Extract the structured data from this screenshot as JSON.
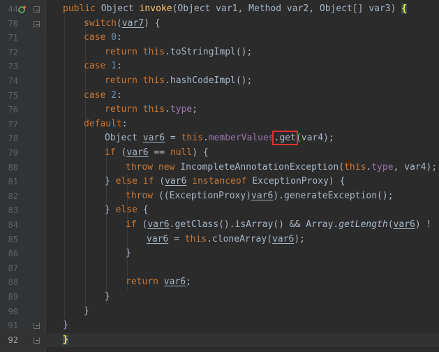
{
  "editor": {
    "lines": [
      {
        "num": "44",
        "tokens": [
          {
            "t": "public",
            "c": "kw"
          },
          {
            "t": " "
          },
          {
            "t": "Object"
          },
          {
            "t": " "
          },
          {
            "t": "invoke",
            "c": "fn"
          },
          {
            "t": "(Object var1, Method var2, Object[] var3) "
          },
          {
            "t": "{",
            "c": "brace-hl"
          }
        ],
        "indent": 0
      },
      {
        "num": "70",
        "tokens": [
          {
            "t": "switch",
            "c": "kw"
          },
          {
            "t": "("
          },
          {
            "t": "var7",
            "c": "var"
          },
          {
            "t": ") {"
          }
        ],
        "indent": 2
      },
      {
        "num": "71",
        "tokens": [
          {
            "t": "case ",
            "c": "kw"
          },
          {
            "t": "0",
            "c": "num"
          },
          {
            "t": ":"
          }
        ],
        "indent": 2
      },
      {
        "num": "72",
        "tokens": [
          {
            "t": "return ",
            "c": "kw"
          },
          {
            "t": "this",
            "c": "kw"
          },
          {
            "t": ".toStringImpl();"
          }
        ],
        "indent": 3
      },
      {
        "num": "73",
        "tokens": [
          {
            "t": "case ",
            "c": "kw"
          },
          {
            "t": "1",
            "c": "num"
          },
          {
            "t": ":"
          }
        ],
        "indent": 2
      },
      {
        "num": "74",
        "tokens": [
          {
            "t": "return ",
            "c": "kw"
          },
          {
            "t": "this",
            "c": "kw"
          },
          {
            "t": ".hashCodeImpl();"
          }
        ],
        "indent": 3
      },
      {
        "num": "75",
        "tokens": [
          {
            "t": "case ",
            "c": "kw"
          },
          {
            "t": "2",
            "c": "num"
          },
          {
            "t": ":"
          }
        ],
        "indent": 2
      },
      {
        "num": "76",
        "tokens": [
          {
            "t": "return ",
            "c": "kw"
          },
          {
            "t": "this",
            "c": "kw"
          },
          {
            "t": "."
          },
          {
            "t": "type",
            "c": "fld"
          },
          {
            "t": ";"
          }
        ],
        "indent": 3
      },
      {
        "num": "77",
        "tokens": [
          {
            "t": "default",
            "c": "kw"
          },
          {
            "t": ":"
          }
        ],
        "indent": 2
      },
      {
        "num": "78",
        "tokens": [
          {
            "t": "Object "
          },
          {
            "t": "var6",
            "c": "var"
          },
          {
            "t": " = "
          },
          {
            "t": "this",
            "c": "kw"
          },
          {
            "t": "."
          },
          {
            "t": "memberValues",
            "c": "fld"
          },
          {
            "t": ".get",
            "c": "redbox"
          },
          {
            "t": "(var4);"
          }
        ],
        "indent": 3
      },
      {
        "num": "79",
        "tokens": [
          {
            "t": "if ",
            "c": "kw"
          },
          {
            "t": "("
          },
          {
            "t": "var6",
            "c": "var"
          },
          {
            "t": " == "
          },
          {
            "t": "null",
            "c": "kw"
          },
          {
            "t": ") {"
          }
        ],
        "indent": 3
      },
      {
        "num": "80",
        "tokens": [
          {
            "t": "throw new ",
            "c": "kw"
          },
          {
            "t": "IncompleteAnnotationException("
          },
          {
            "t": "this",
            "c": "kw"
          },
          {
            "t": "."
          },
          {
            "t": "type",
            "c": "fld"
          },
          {
            "t": ", var4);"
          }
        ],
        "indent": 4
      },
      {
        "num": "81",
        "tokens": [
          {
            "t": "} "
          },
          {
            "t": "else if ",
            "c": "kw"
          },
          {
            "t": "("
          },
          {
            "t": "var6",
            "c": "var"
          },
          {
            "t": " "
          },
          {
            "t": "instanceof ",
            "c": "kw"
          },
          {
            "t": "ExceptionProxy) {"
          }
        ],
        "indent": 3
      },
      {
        "num": "82",
        "tokens": [
          {
            "t": "throw ",
            "c": "kw"
          },
          {
            "t": "((ExceptionProxy)"
          },
          {
            "t": "var6",
            "c": "var"
          },
          {
            "t": ").generateException();"
          }
        ],
        "indent": 4
      },
      {
        "num": "83",
        "tokens": [
          {
            "t": "} "
          },
          {
            "t": "else ",
            "c": "kw"
          },
          {
            "t": "{"
          }
        ],
        "indent": 3
      },
      {
        "num": "84",
        "tokens": [
          {
            "t": "if ",
            "c": "kw"
          },
          {
            "t": "("
          },
          {
            "t": "var6",
            "c": "var"
          },
          {
            "t": ".getClass().isArray() && Array."
          },
          {
            "t": "getLength",
            "c": "it"
          },
          {
            "t": "("
          },
          {
            "t": "var6",
            "c": "var"
          },
          {
            "t": ") !"
          }
        ],
        "indent": 4
      },
      {
        "num": "85",
        "tokens": [
          {
            "t": "var6",
            "c": "var"
          },
          {
            "t": " = "
          },
          {
            "t": "this",
            "c": "kw"
          },
          {
            "t": ".cloneArray("
          },
          {
            "t": "var6",
            "c": "var"
          },
          {
            "t": ");"
          }
        ],
        "indent": 5
      },
      {
        "num": "86",
        "tokens": [
          {
            "t": "}"
          }
        ],
        "indent": 4
      },
      {
        "num": "87",
        "tokens": [],
        "indent": 0
      },
      {
        "num": "88",
        "tokens": [
          {
            "t": "return ",
            "c": "kw"
          },
          {
            "t": "var6",
            "c": "var"
          },
          {
            "t": ";"
          }
        ],
        "indent": 4
      },
      {
        "num": "89",
        "tokens": [
          {
            "t": "}"
          }
        ],
        "indent": 3
      },
      {
        "num": "90",
        "tokens": [
          {
            "t": "}"
          }
        ],
        "indent": 2
      },
      {
        "num": "91",
        "tokens": [
          {
            "t": "}"
          }
        ],
        "indent": 1
      },
      {
        "num": "92",
        "tokens": [
          {
            "t": "}",
            "c": "brace-hl"
          }
        ],
        "indent": 0
      }
    ],
    "current_line": "92",
    "colors": {
      "background": "#2b2b2b",
      "keyword": "#cc7832",
      "method_decl": "#ffc66d",
      "field": "#9876aa",
      "number": "#6897bb",
      "text": "#a9b7c6",
      "highlight_box": "#e0302f"
    },
    "gutter_icons": [
      "override-marker-icon",
      "fold-toggle-icon"
    ]
  }
}
